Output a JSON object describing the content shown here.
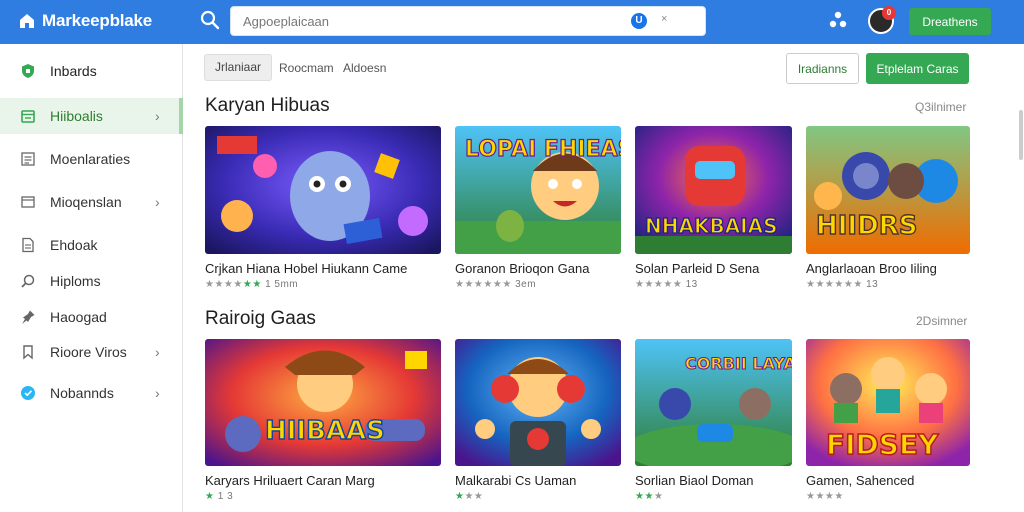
{
  "topbar": {
    "brand": "Markeepblake",
    "search_placeholder": "Agpoeplaicaan",
    "search_badge": "U",
    "search_clear": "×",
    "notif_count": "0",
    "action_label": "Dreathens"
  },
  "sidebar": {
    "items": [
      {
        "label": "Inbards",
        "icon": "shield-icon",
        "chevron": false
      },
      {
        "label": "Hiiboalis",
        "icon": "calendar-icon",
        "chevron": true,
        "active": true
      },
      {
        "label": "Moenlaraties",
        "icon": "list-icon",
        "chevron": false
      },
      {
        "label": "Mioqenslan",
        "icon": "window-icon",
        "chevron": true
      },
      {
        "label": "Ehdoak",
        "icon": "document-icon",
        "chevron": false
      },
      {
        "label": "Hiploms",
        "icon": "search-icon",
        "chevron": false
      },
      {
        "label": "Haoogad",
        "icon": "pin-icon",
        "chevron": false
      },
      {
        "label": "Rioore Viros",
        "icon": "bookmark-icon",
        "chevron": true
      },
      {
        "label": "Nobannds",
        "icon": "globe-icon",
        "chevron": true
      }
    ]
  },
  "filters": {
    "pill": "Jrlaniaar",
    "link1": "Roocmam",
    "link2": "Aldoesn",
    "outline_button": "Iradianns",
    "green_button": "Etplelam Caras"
  },
  "sections": [
    {
      "title": "Karyan Hibuas",
      "more": "Q3ilnimer",
      "cards": [
        {
          "title": "Crjkan Hiana Hobel Hiukann Came",
          "rating": "1 5mm",
          "stars_green": 2
        },
        {
          "title": "Goranon Brioqon Gana",
          "rating": "3em",
          "stars_green": 0
        },
        {
          "title": "Solan Parleid D Sena",
          "rating": "13",
          "stars_green": 0
        },
        {
          "title": "Anglarlaoan Broo Iiling",
          "rating": "13",
          "stars_green": 0
        }
      ]
    },
    {
      "title": "Rairoig Gaas",
      "more": "2Dsimner",
      "cards": [
        {
          "title": "Karyars Hriluaert Caran Marg",
          "rating": "1 3",
          "stars_green": 1
        },
        {
          "title": "Malkarabi Cs Uaman",
          "rating": "",
          "stars_green": 1
        },
        {
          "title": "Sorlian Biaol Doman",
          "rating": "",
          "stars_green": 2
        },
        {
          "title": "Gamen, Sahenced",
          "rating": "",
          "stars_green": 0
        }
      ]
    }
  ],
  "thumb_texts": [
    "",
    "LOPAI FHIEAS",
    "NHAKBAIAS",
    "HIIDRS",
    "HIIBAAS",
    "",
    "CORBII LAYAL",
    "FIDSEY"
  ],
  "colors": {
    "topbar": "#2f7de1",
    "accent_green": "#34a853",
    "active_bg": "#e9f5ea"
  }
}
